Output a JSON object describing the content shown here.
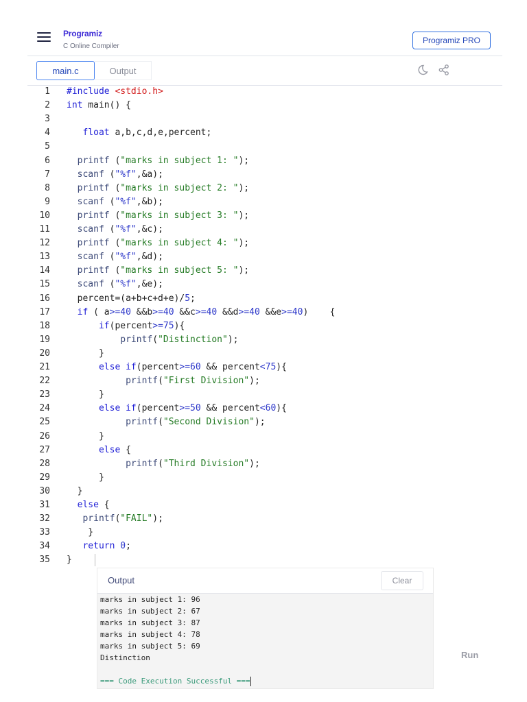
{
  "header": {
    "logo": "Programiz",
    "subtitle": "C Online Compiler",
    "pro_button": "Programiz PRO"
  },
  "tabs": [
    {
      "label": "main.c",
      "active": true
    },
    {
      "label": "Output",
      "active": false
    }
  ],
  "toolbar_icons": [
    "moon-icon",
    "share-icon"
  ],
  "colors": {
    "accent": "#2f6fe0",
    "keyword": "#1f1fd6",
    "string": "#237a23",
    "include": "#d21a1a"
  },
  "code": {
    "lines": [
      [
        [
          "k",
          "#include "
        ],
        [
          "r",
          "<stdio.h>"
        ]
      ],
      [
        [
          "k",
          "int"
        ],
        [
          "p",
          " main() {"
        ]
      ],
      [],
      [
        [
          "p",
          "   "
        ],
        [
          "k",
          "float"
        ],
        [
          "p",
          " a,b,c,d,e,percent;"
        ]
      ],
      [],
      [
        [
          "p",
          "  "
        ],
        [
          "f",
          "printf"
        ],
        [
          "p",
          " ("
        ],
        [
          "s",
          "\"marks in subject 1: \""
        ],
        [
          "p",
          ");"
        ]
      ],
      [
        [
          "p",
          "  "
        ],
        [
          "f",
          "scanf"
        ],
        [
          "p",
          " ("
        ],
        [
          "n",
          "\"%f\""
        ],
        [
          "p",
          ",&a);"
        ]
      ],
      [
        [
          "p",
          "  "
        ],
        [
          "f",
          "printf"
        ],
        [
          "p",
          " ("
        ],
        [
          "s",
          "\"marks in subject 2: \""
        ],
        [
          "p",
          ");"
        ]
      ],
      [
        [
          "p",
          "  "
        ],
        [
          "f",
          "scanf"
        ],
        [
          "p",
          " ("
        ],
        [
          "n",
          "\"%f\""
        ],
        [
          "p",
          ",&b);"
        ]
      ],
      [
        [
          "p",
          "  "
        ],
        [
          "f",
          "printf"
        ],
        [
          "p",
          " ("
        ],
        [
          "s",
          "\"marks in subject 3: \""
        ],
        [
          "p",
          ");"
        ]
      ],
      [
        [
          "p",
          "  "
        ],
        [
          "f",
          "scanf"
        ],
        [
          "p",
          " ("
        ],
        [
          "n",
          "\"%f\""
        ],
        [
          "p",
          ",&c);"
        ]
      ],
      [
        [
          "p",
          "  "
        ],
        [
          "f",
          "printf"
        ],
        [
          "p",
          " ("
        ],
        [
          "s",
          "\"marks in subject 4: \""
        ],
        [
          "p",
          ");"
        ]
      ],
      [
        [
          "p",
          "  "
        ],
        [
          "f",
          "scanf"
        ],
        [
          "p",
          " ("
        ],
        [
          "n",
          "\"%f\""
        ],
        [
          "p",
          ",&d);"
        ]
      ],
      [
        [
          "p",
          "  "
        ],
        [
          "f",
          "printf"
        ],
        [
          "p",
          " ("
        ],
        [
          "s",
          "\"marks in subject 5: \""
        ],
        [
          "p",
          ");"
        ]
      ],
      [
        [
          "p",
          "  "
        ],
        [
          "f",
          "scanf"
        ],
        [
          "p",
          " ("
        ],
        [
          "n",
          "\"%f\""
        ],
        [
          "p",
          ",&e);"
        ]
      ],
      [
        [
          "p",
          "  percent=(a+b+c+d+e)/"
        ],
        [
          "n",
          "5"
        ],
        [
          "p",
          ";"
        ]
      ],
      [
        [
          "p",
          "  "
        ],
        [
          "k",
          "if"
        ],
        [
          "p",
          " ( a"
        ],
        [
          "n",
          ">=40"
        ],
        [
          "p",
          " &&b"
        ],
        [
          "n",
          ">=40"
        ],
        [
          "p",
          " &&c"
        ],
        [
          "n",
          ">=40"
        ],
        [
          "p",
          " &&d"
        ],
        [
          "n",
          ">=40"
        ],
        [
          "p",
          " &&e"
        ],
        [
          "n",
          ">=40"
        ],
        [
          "p",
          ")    {"
        ]
      ],
      [
        [
          "p",
          "      "
        ],
        [
          "k",
          "if"
        ],
        [
          "p",
          "(percent"
        ],
        [
          "n",
          ">=75"
        ],
        [
          "p",
          "){"
        ]
      ],
      [
        [
          "p",
          "          "
        ],
        [
          "f",
          "printf"
        ],
        [
          "p",
          "("
        ],
        [
          "s",
          "\"Distinction\""
        ],
        [
          "p",
          ");"
        ]
      ],
      [
        [
          "p",
          "      }"
        ]
      ],
      [
        [
          "p",
          "      "
        ],
        [
          "k",
          "else"
        ],
        [
          "p",
          " "
        ],
        [
          "k",
          "if"
        ],
        [
          "p",
          "(percent"
        ],
        [
          "n",
          ">=60"
        ],
        [
          "p",
          " && percent"
        ],
        [
          "n",
          "<75"
        ],
        [
          "p",
          "){"
        ]
      ],
      [
        [
          "p",
          "           "
        ],
        [
          "f",
          "printf"
        ],
        [
          "p",
          "("
        ],
        [
          "s",
          "\"First Division\""
        ],
        [
          "p",
          ");"
        ]
      ],
      [
        [
          "p",
          "      }"
        ]
      ],
      [
        [
          "p",
          "      "
        ],
        [
          "k",
          "else"
        ],
        [
          "p",
          " "
        ],
        [
          "k",
          "if"
        ],
        [
          "p",
          "(percent"
        ],
        [
          "n",
          ">=50"
        ],
        [
          "p",
          " && percent"
        ],
        [
          "n",
          "<60"
        ],
        [
          "p",
          "){"
        ]
      ],
      [
        [
          "p",
          "           "
        ],
        [
          "f",
          "printf"
        ],
        [
          "p",
          "("
        ],
        [
          "s",
          "\"Second Division\""
        ],
        [
          "p",
          ");"
        ]
      ],
      [
        [
          "p",
          "      }"
        ]
      ],
      [
        [
          "p",
          "      "
        ],
        [
          "k",
          "else"
        ],
        [
          "p",
          " {"
        ]
      ],
      [
        [
          "p",
          "           "
        ],
        [
          "f",
          "printf"
        ],
        [
          "p",
          "("
        ],
        [
          "s",
          "\"Third Division\""
        ],
        [
          "p",
          ");"
        ]
      ],
      [
        [
          "p",
          "      }"
        ]
      ],
      [
        [
          "p",
          "  }"
        ]
      ],
      [
        [
          "p",
          "  "
        ],
        [
          "k",
          "else"
        ],
        [
          "p",
          " {"
        ]
      ],
      [
        [
          "p",
          "   "
        ],
        [
          "f",
          "printf"
        ],
        [
          "p",
          "("
        ],
        [
          "s",
          "\"FAIL\""
        ],
        [
          "p",
          ");"
        ]
      ],
      [
        [
          "p",
          "    }"
        ]
      ],
      [
        [
          "p",
          "   "
        ],
        [
          "k",
          "return"
        ],
        [
          "p",
          " "
        ],
        [
          "n",
          "0"
        ],
        [
          "p",
          ";"
        ]
      ],
      [
        [
          "p",
          "}"
        ]
      ]
    ]
  },
  "output": {
    "title": "Output",
    "clear_button": "Clear",
    "lines": [
      "marks in subject 1: 96",
      "marks in subject 2: 67",
      "marks in subject 3: 87",
      "marks in subject 4: 78",
      "marks in subject 5: 69",
      "Distinction",
      ""
    ],
    "status": "=== Code Execution Successful ==="
  },
  "run_button": "Run"
}
